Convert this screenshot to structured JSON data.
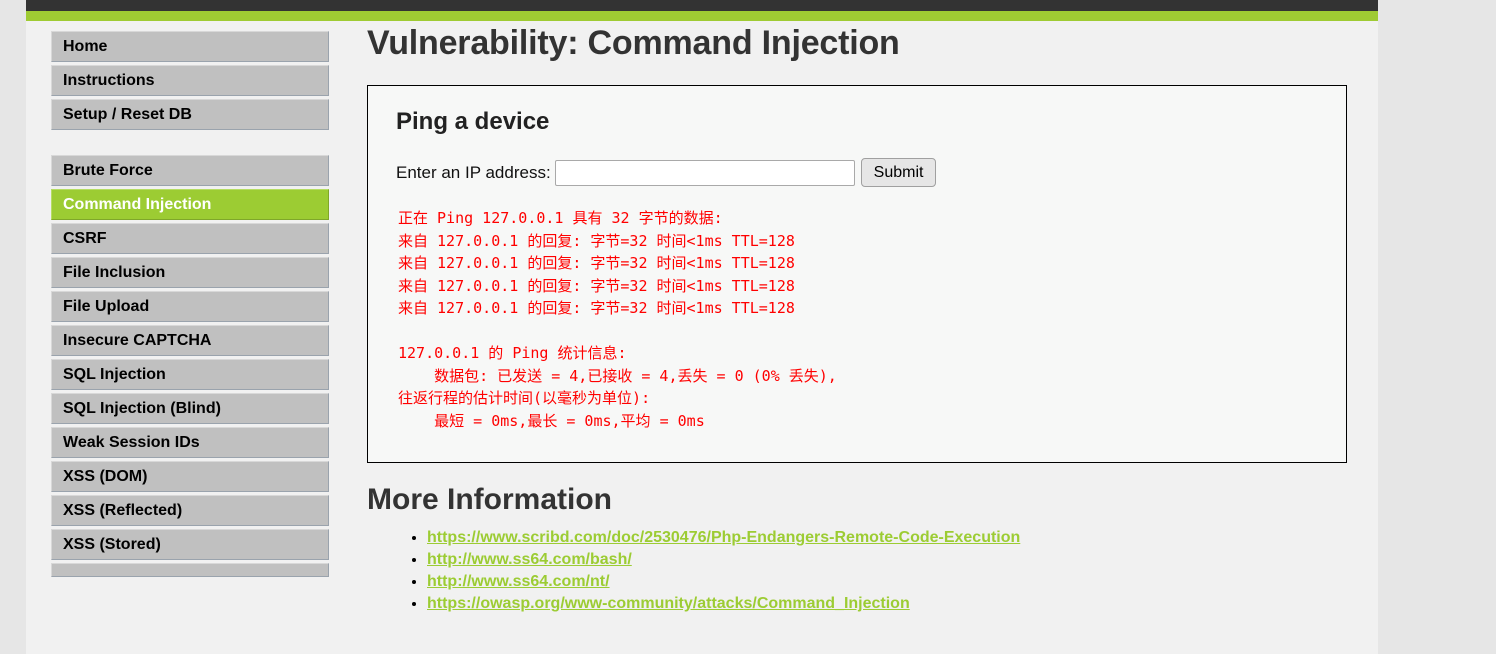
{
  "header": {
    "dark_bar_color": "#333333",
    "green_bar_color": "#9fcb33"
  },
  "sidebar": {
    "groups": [
      {
        "items": [
          {
            "label": "Home",
            "active": false
          },
          {
            "label": "Instructions",
            "active": false
          },
          {
            "label": "Setup / Reset DB",
            "active": false
          }
        ]
      },
      {
        "items": [
          {
            "label": "Brute Force",
            "active": false
          },
          {
            "label": "Command Injection",
            "active": true
          },
          {
            "label": "CSRF",
            "active": false
          },
          {
            "label": "File Inclusion",
            "active": false
          },
          {
            "label": "File Upload",
            "active": false
          },
          {
            "label": "Insecure CAPTCHA",
            "active": false
          },
          {
            "label": "SQL Injection",
            "active": false
          },
          {
            "label": "SQL Injection (Blind)",
            "active": false
          },
          {
            "label": "Weak Session IDs",
            "active": false
          },
          {
            "label": "XSS (DOM)",
            "active": false
          },
          {
            "label": "XSS (Reflected)",
            "active": false
          },
          {
            "label": "XSS (Stored)",
            "active": false
          },
          {
            "label": "",
            "active": false
          }
        ]
      }
    ],
    "active_bg_color": "#9ccc33",
    "item_bg_color": "#c0c0c0"
  },
  "main": {
    "page_title": "Vulnerability: Command Injection",
    "vuln_box": {
      "title": "Ping a device",
      "form": {
        "label": "Enter an IP address:",
        "input_value": "",
        "input_placeholder": "",
        "submit_label": "Submit"
      },
      "ping_output": "正在 Ping 127.0.0.1 具有 32 字节的数据:\n来自 127.0.0.1 的回复: 字节=32 时间<1ms TTL=128\n来自 127.0.0.1 的回复: 字节=32 时间<1ms TTL=128\n来自 127.0.0.1 的回复: 字节=32 时间<1ms TTL=128\n来自 127.0.0.1 的回复: 字节=32 时间<1ms TTL=128\n\n127.0.0.1 的 Ping 统计信息:\n    数据包: 已发送 = 4,已接收 = 4,丢失 = 0 (0% 丢失),\n往返行程的估计时间(以毫秒为单位):\n    最短 = 0ms,最长 = 0ms,平均 = 0ms",
      "output_color": "#ff0000"
    },
    "more_information": {
      "heading": "More Information",
      "links": [
        "https://www.scribd.com/doc/2530476/Php-Endangers-Remote-Code-Execution",
        "http://www.ss64.com/bash/",
        "http://www.ss64.com/nt/",
        "https://owasp.org/www-community/attacks/Command_Injection"
      ],
      "link_color": "#9ccc33"
    }
  }
}
